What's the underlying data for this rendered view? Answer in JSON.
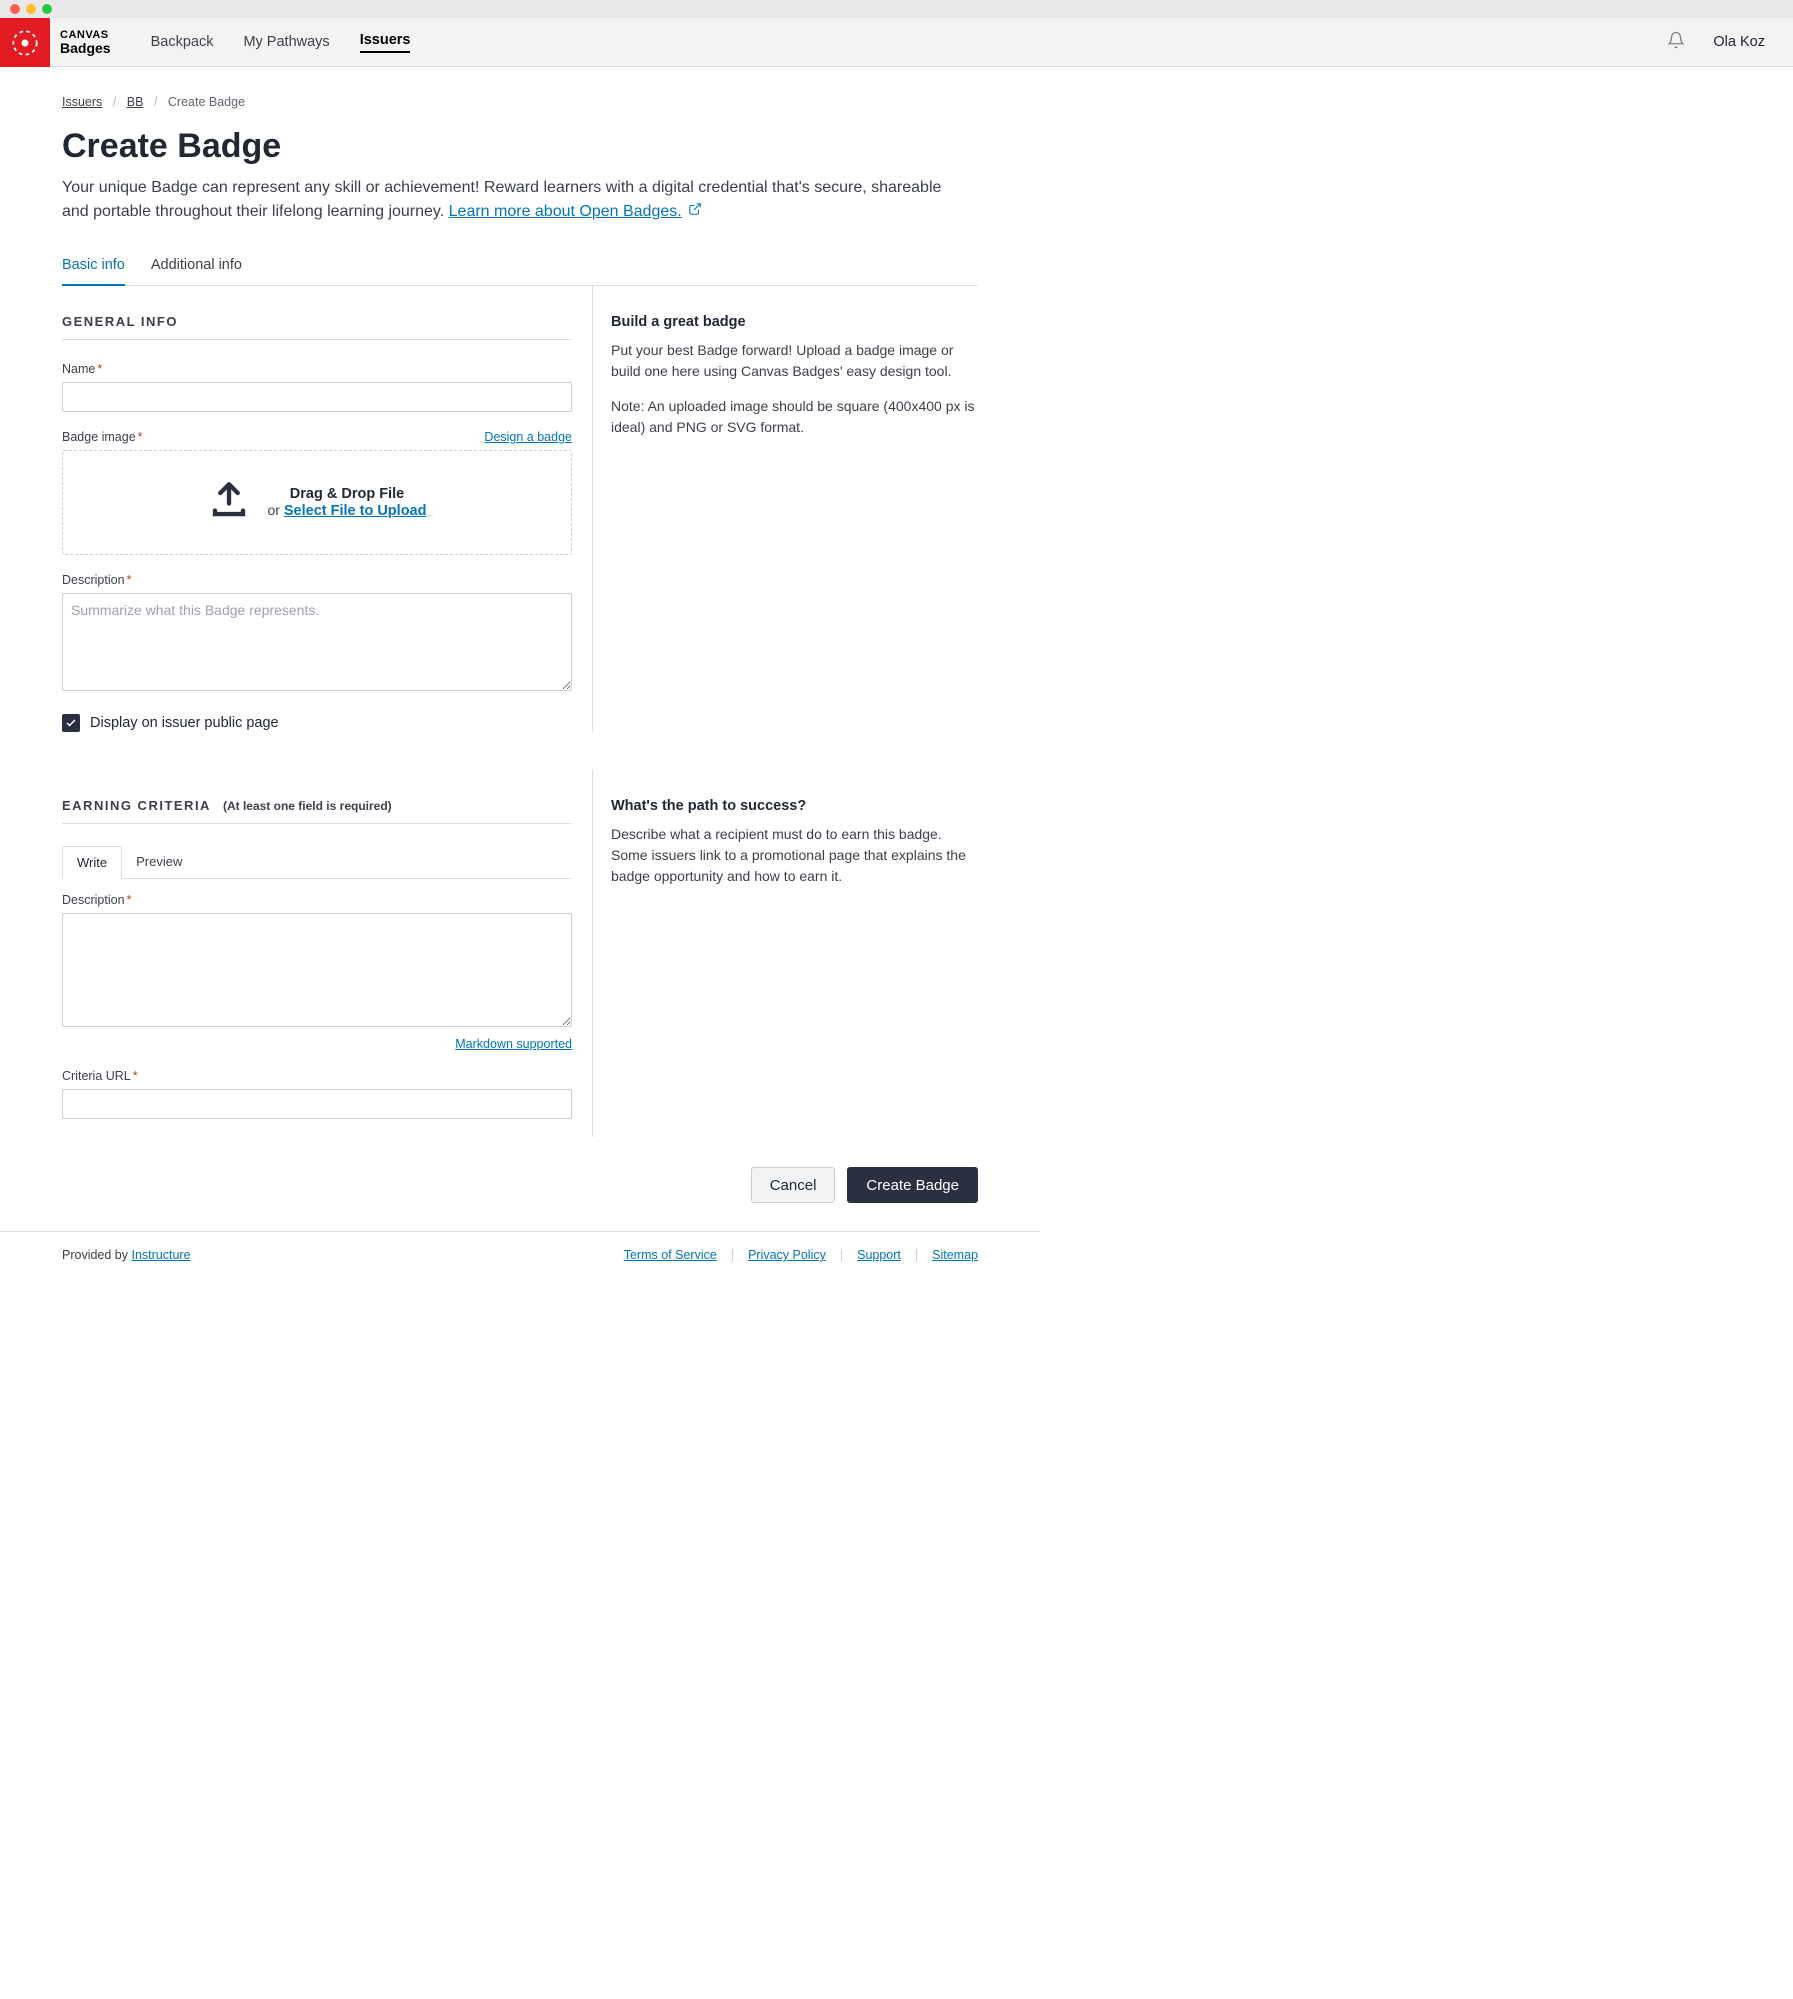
{
  "brand": {
    "line1": "CANVAS",
    "line2": "Badges"
  },
  "nav": {
    "backpack": "Backpack",
    "pathways": "My Pathways",
    "issuers": "Issuers"
  },
  "user": {
    "name": "Ola Koz"
  },
  "breadcrumb": {
    "issuers": "Issuers",
    "bb": "BB",
    "current": "Create Badge"
  },
  "page_title": "Create Badge",
  "subtitle_text": "Your unique Badge can represent any skill or achievement! Reward learners with a digital credential that's secure, shareable and portable throughout their lifelong learning journey. ",
  "learn_more": "Learn more about Open Badges.",
  "tabs": {
    "basic": "Basic info",
    "additional": "Additional info"
  },
  "general": {
    "heading": "GENERAL INFO",
    "name_label": "Name",
    "badge_image_label": "Badge image",
    "design_link": "Design a badge",
    "drop_title": "Drag & Drop File",
    "drop_or": "or ",
    "drop_select": "Select File to Upload",
    "description_label": "Description",
    "description_placeholder": "Summarize what this Badge represents.",
    "display_public": "Display on issuer public page"
  },
  "aside_general": {
    "heading": "Build a great badge",
    "p1": "Put your best Badge forward! Upload a badge image or build one here using Canvas Badges' easy design tool.",
    "p2": "Note: An uploaded image should be square (400x400 px is ideal) and PNG or SVG format."
  },
  "earning": {
    "heading": "EARNING CRITERIA",
    "note": "(At least one field is required)",
    "subtabs": {
      "write": "Write",
      "preview": "Preview"
    },
    "description_label": "Description",
    "url_label": "Criteria URL",
    "markdown": "Markdown supported"
  },
  "aside_earning": {
    "heading": "What's the path to success?",
    "p1": "Describe what a recipient must do to earn this badge. Some issuers link to a promotional page that explains the badge opportunity and how to earn it."
  },
  "actions": {
    "cancel": "Cancel",
    "create": "Create Badge"
  },
  "footer": {
    "provided_by": "Provided by ",
    "instructure": "Instructure",
    "terms": "Terms of Service",
    "privacy": "Privacy Policy",
    "support": "Support",
    "sitemap": "Sitemap"
  }
}
